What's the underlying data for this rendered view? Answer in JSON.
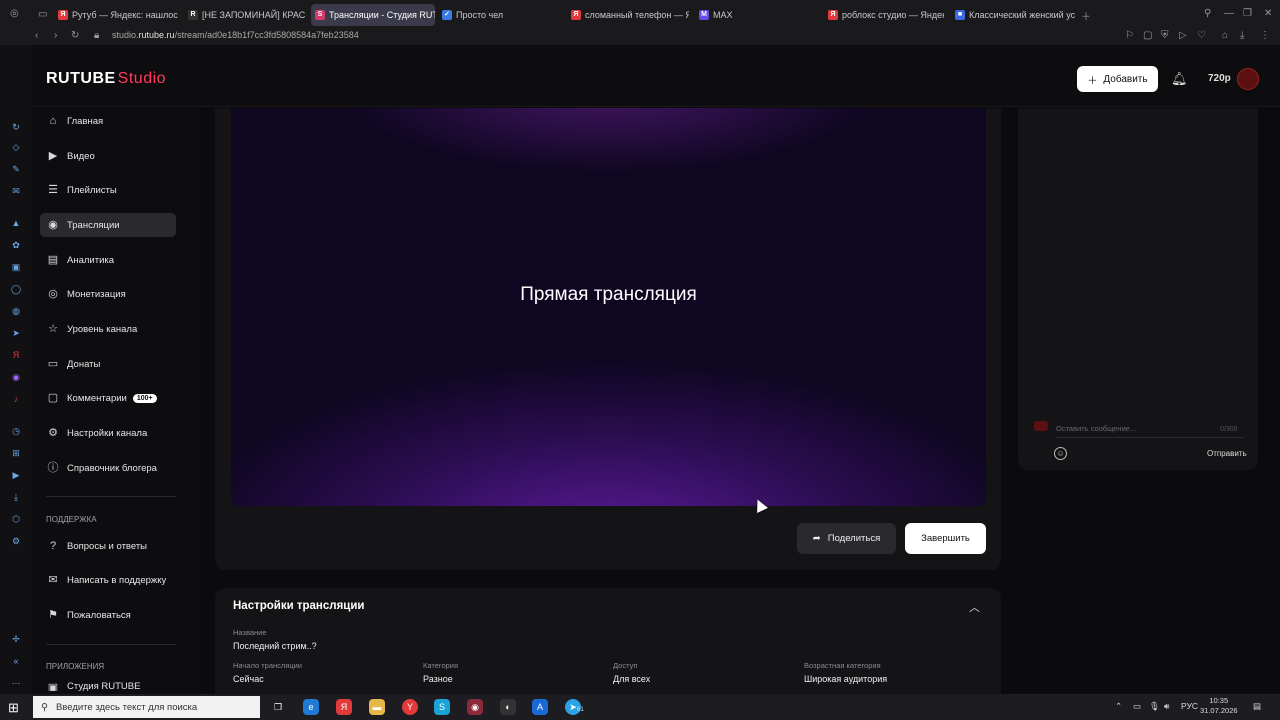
{
  "browser": {
    "tabs": [
      {
        "label": "Рутуб — Яндекс: нашлось",
        "icon": "yandex-icon",
        "color": "#e23a3a"
      },
      {
        "label": "[НЕ ЗАПОМИНАЙ] КРАСН",
        "icon": "rutube-icon",
        "color": "#222"
      },
      {
        "label": "Трансляции - Студия RUTU",
        "icon": "rutube-studio-icon",
        "color": "#d23a6a",
        "active": true
      },
      {
        "label": "Просто чел",
        "icon": "check-icon",
        "color": "#3a7ae2"
      },
      {
        "label": "сломанный телефон — Ян",
        "icon": "yandex-icon",
        "color": "#e23a3a"
      },
      {
        "label": "MAX",
        "icon": "max-icon",
        "color": "#6a4ae2"
      },
      {
        "label": "роблокс студио — Яндекс",
        "icon": "yandex-icon",
        "color": "#e23a3a"
      },
      {
        "label": "Классический женский ус",
        "icon": "site-icon",
        "color": "#3a6ae2"
      }
    ],
    "url_prefix": "studio.",
    "url_domain": "rutube.ru",
    "url_path": "/stream/ad0e18b1f7cc3fd5808584a7feb23584"
  },
  "header": {
    "logo_main": "RUTUBE",
    "logo_sub": "Studio",
    "add_button": "Добавить",
    "quality": "720p"
  },
  "sidebar": {
    "items": [
      {
        "label": "Главная",
        "icon": "home-icon"
      },
      {
        "label": "Видео",
        "icon": "video-icon"
      },
      {
        "label": "Плейлисты",
        "icon": "playlist-icon"
      },
      {
        "label": "Трансляции",
        "icon": "broadcast-icon",
        "active": true
      },
      {
        "label": "Аналитика",
        "icon": "analytics-icon"
      },
      {
        "label": "Монетизация",
        "icon": "money-icon"
      },
      {
        "label": "Уровень канала",
        "icon": "star-icon"
      },
      {
        "label": "Донаты",
        "icon": "donate-icon"
      },
      {
        "label": "Комментарии",
        "icon": "comment-icon",
        "badge": "100+"
      },
      {
        "label": "Настройки канала",
        "icon": "settings-icon"
      },
      {
        "label": "Справочник блогера",
        "icon": "info-icon"
      }
    ],
    "support_title": "ПОДДЕРЖКА",
    "support_items": [
      {
        "label": "Вопросы и ответы",
        "icon": "help-icon"
      },
      {
        "label": "Написать в поддержку",
        "icon": "mail-icon"
      },
      {
        "label": "Пожаловаться",
        "icon": "flag-icon"
      }
    ],
    "apps_title": "ПРИЛОЖЕНИЯ",
    "apps_item": "Студия RUTUBE"
  },
  "player": {
    "title": "Прямая трансляция"
  },
  "actions": {
    "share": "Поделиться",
    "finish": "Завершить"
  },
  "chat": {
    "placeholder": "Оставить сообщение...",
    "counter": "0/300",
    "send": "Отправить"
  },
  "settings": {
    "title": "Настройки трансляции",
    "name_label": "Название",
    "name_value": "Последний стрим..?",
    "fields": [
      {
        "label": "Начало трансляции",
        "value": "Сейчас"
      },
      {
        "label": "Категория",
        "value": "Разное"
      },
      {
        "label": "Доступ",
        "value": "Для всех"
      },
      {
        "label": "Возрастная категория",
        "value": "Широкая аудитория"
      }
    ]
  },
  "taskbar": {
    "search_placeholder": "Введите здесь текст для поиска",
    "telegram_badge": "61",
    "lang": "РУС",
    "time": "10:35",
    "date": "31.07.2026"
  }
}
